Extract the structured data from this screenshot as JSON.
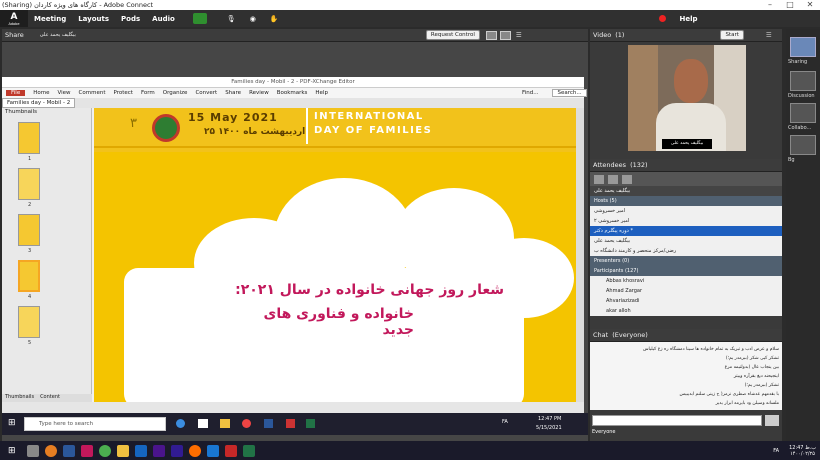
{
  "window": {
    "title": "(Sharing) کارگاه های ویژه کاردان - Adobe Connect"
  },
  "menubar": {
    "logo": "Adobe",
    "items": [
      "Meeting",
      "Layouts",
      "Pods",
      "Audio"
    ],
    "help": "Help"
  },
  "share": {
    "title": "Share",
    "presenter": "بیگلیف یحمد علی",
    "request_control": "Request Control"
  },
  "pdf": {
    "title": "Families day - Mobil - 2 - PDF-XChange Editor",
    "menu": [
      "File",
      "Home",
      "View",
      "Comment",
      "Protect",
      "Form",
      "Organize",
      "Convert",
      "Share",
      "Review",
      "Bookmarks",
      "Help"
    ],
    "find": "Find...",
    "search": "Search...",
    "tab": "Families day - Mobil - 2",
    "thumbs_title": "Thumbnails",
    "thumbs_tabs": [
      "Thumbnails",
      "Content"
    ],
    "page_nums": [
      "1",
      "2",
      "3",
      "4",
      "5"
    ],
    "poster": {
      "date": "15 May 2021",
      "persian_date": "۲۵ اردیبهشت ماه ۱۴۰۰",
      "num": "۳",
      "intl1": "INTERNATIONAL",
      "intl2": "DAY OF FAMILIES",
      "line1": "شعار روز جهانی خانواده در سال ۲۰۲۱:",
      "line2": "خانواده و فناوری های جدید"
    }
  },
  "taskbar_inner": {
    "search": "Type here to search",
    "time": "12:47 PM",
    "date": "5/15/2021",
    "lang": "FA"
  },
  "video": {
    "title": "Video",
    "count": "(1)",
    "start": "Start",
    "name": "بیگلیف یحمد علی"
  },
  "attendees": {
    "title": "Attendees",
    "count": "(132)",
    "presenter": "بیگلیف یحمد علی",
    "hosts_label": "Hosts (5)",
    "hosts": [
      "امیر خسروشی",
      "امیر خسروشی ۲",
      "* دوره پیگلرم دکتر",
      "بیگلیف یحمد علی",
      "رضی/مرکز منحصر و کارمند دانشگاه ب"
    ],
    "presenters_label": "Presenters (0)",
    "participants_label": "Participants (127)",
    "participants": [
      "Abbas khosravi",
      "Ahmad Zargar",
      "Ahvariazizadi",
      "akar alloh"
    ]
  },
  "chat": {
    "title": "Chat",
    "scope": "(Everyone)",
    "messages": [
      "سلام و عرض ادب و تبریک به تمام خانواده  ها سینا دمشگاه ره زغ کیلیاس",
      "تشکر کیی شکر (ببرمدر  یم؛)",
      "بین ینجاب عال (بدولتیمه مرغ",
      "اینجیحنه دیغ بقرآره وییتز",
      "تشکر (ببرمدر  یم؛)",
      "با بقدمهم عدشاه صطری نرمر( ح زینی سلنم ابدیبیس",
      "ملسانه وسیلن ود بایرمه ابرار یدیر"
    ],
    "to": "Everyone"
  },
  "system": {
    "time": "12:47 ب.ظ",
    "date": "۱۴۰۰/۰۲/۲۵",
    "lang": "FA"
  },
  "strip": {
    "labels": [
      "Sharing",
      "Discussion",
      "Collabo...",
      "Bg"
    ]
  }
}
